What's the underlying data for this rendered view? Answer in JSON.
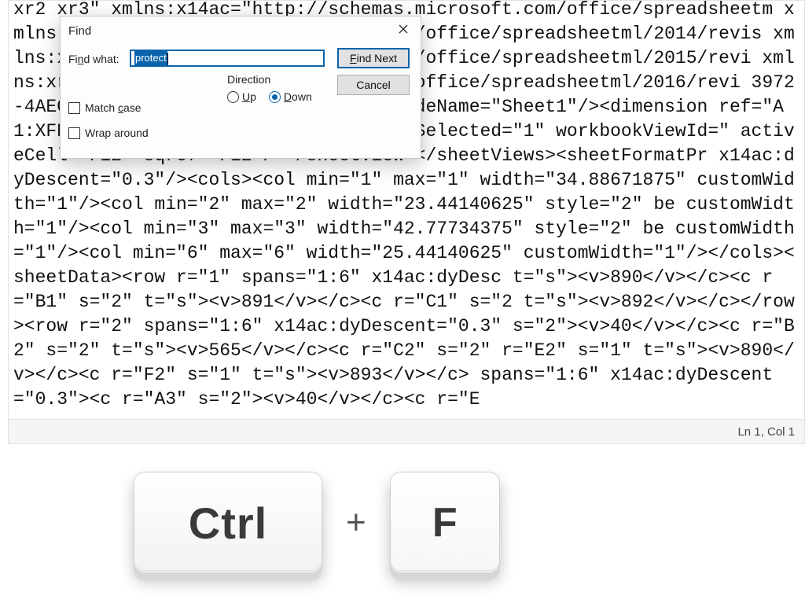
{
  "editor": {
    "text": "xr2 xr3\" xmlns:x14ac=\"http://schemas.microsoft.com/office/spreadsheetm xmlns:xr=\"http://schemas.microsoft.com/office/spreadsheetml/2014/revis xmlns:xr2=\"http://schemas.microsoft.com/office/spreadsheetml/2015/revi xmlns:xr3=\"http://schemas.microsoft.com/office/spreadsheetml/2016/revi 3972-4AEC-B0D6-D47CC392F09F}\"><sheetPr codeName=\"Sheet1\"/><dimension ref=\"A1:XFD161\"/><sheetViews><sheetView tabSelected=\"1\" workbookViewId=\" activeCell=\"F12\" sqref=\"F12\"/></sheetView></sheetViews><sheetFormatPr x14ac:dyDescent=\"0.3\"/><cols><col min=\"1\" max=\"1\" width=\"34.88671875\" customWidth=\"1\"/><col min=\"2\" max=\"2\" width=\"23.44140625\" style=\"2\" be customWidth=\"1\"/><col min=\"3\" max=\"3\" width=\"42.77734375\" style=\"2\" be customWidth=\"1\"/><col min=\"6\" max=\"6\" width=\"25.44140625\" customWidth=\"1\"/></cols><sheetData><row r=\"1\" spans=\"1:6\" x14ac:dyDesc t=\"s\"><v>890</v></c><c r=\"B1\" s=\"2\" t=\"s\"><v>891</v></c><c r=\"C1\" s=\"2 t=\"s\"><v>892</v></c></row><row r=\"2\" spans=\"1:6\" x14ac:dyDescent=\"0.3\" s=\"2\"><v>40</v></c><c r=\"B2\" s=\"2\" t=\"s\"><v>565</v></c><c r=\"C2\" s=\"2\" r=\"E2\" s=\"1\" t=\"s\"><v>890</v></c><c r=\"F2\" s=\"1\" t=\"s\"><v>893</v></c> spans=\"1:6\" x14ac:dyDescent=\"0.3\"><c r=\"A3\" s=\"2\"><v>40</v></c><c r=\"E"
  },
  "statusbar": {
    "position": "Ln 1, Col 1"
  },
  "find": {
    "title": "Find",
    "find_what_label": "Find what:",
    "find_what_value": "protect",
    "find_next": "Find Next",
    "find_next_mn": "F",
    "cancel": "Cancel",
    "direction_label": "Direction",
    "up_label": "Up",
    "up_mn": "U",
    "down_label": "Down",
    "down_mn": "D",
    "direction_selected": "down",
    "match_case_label": "Match case",
    "match_case_mn": "c",
    "match_case_checked": false,
    "wrap_around_label": "Wrap around",
    "wrap_around_checked": false
  },
  "keys": {
    "ctrl": "Ctrl",
    "plus": "+",
    "f": "F"
  }
}
